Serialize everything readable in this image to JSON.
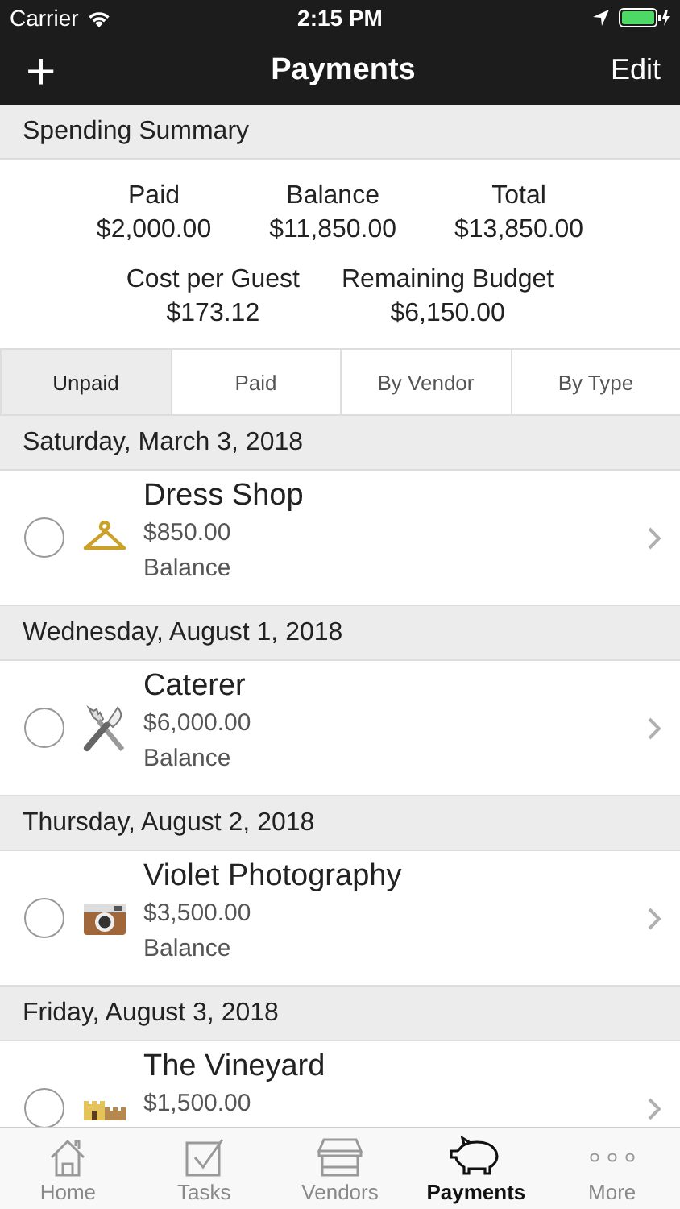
{
  "status_bar": {
    "carrier": "Carrier",
    "time": "2:15 PM"
  },
  "nav": {
    "add_button": "+",
    "title": "Payments",
    "edit_button": "Edit"
  },
  "summary": {
    "title": "Spending Summary",
    "rows": [
      [
        {
          "label": "Paid",
          "value": "$2,000.00"
        },
        {
          "label": "Balance",
          "value": "$11,850.00"
        },
        {
          "label": "Total",
          "value": "$13,850.00"
        }
      ],
      [
        {
          "label": "Cost per Guest",
          "value": "$173.12"
        },
        {
          "label": "Remaining Budget",
          "value": "$6,150.00"
        }
      ]
    ]
  },
  "segments": [
    {
      "label": "Unpaid",
      "selected": true
    },
    {
      "label": "Paid",
      "selected": false
    },
    {
      "label": "By Vendor",
      "selected": false
    },
    {
      "label": "By Type",
      "selected": false
    }
  ],
  "groups": [
    {
      "date": "Saturday, March 3, 2018",
      "payments": [
        {
          "name": "Dress Shop",
          "amount": "$850.00",
          "status": "Balance",
          "paid": false
        }
      ]
    },
    {
      "date": "Wednesday, August 1, 2018",
      "payments": [
        {
          "name": "Caterer",
          "amount": "$6,000.00",
          "status": "Balance",
          "paid": false
        }
      ]
    },
    {
      "date": "Thursday, August 2, 2018",
      "payments": [
        {
          "name": "Violet Photography",
          "amount": "$3,500.00",
          "status": "Balance",
          "paid": false
        }
      ]
    },
    {
      "date": "Friday, August 3, 2018",
      "payments": [
        {
          "name": "The Vineyard",
          "amount": "$1,500.00",
          "paid": false
        }
      ]
    }
  ],
  "tab_bar": [
    {
      "label": "Home",
      "selected": false
    },
    {
      "label": "Tasks",
      "selected": false
    },
    {
      "label": "Vendors",
      "selected": false
    },
    {
      "label": "Payments",
      "selected": true
    },
    {
      "label": "More",
      "selected": false
    }
  ]
}
